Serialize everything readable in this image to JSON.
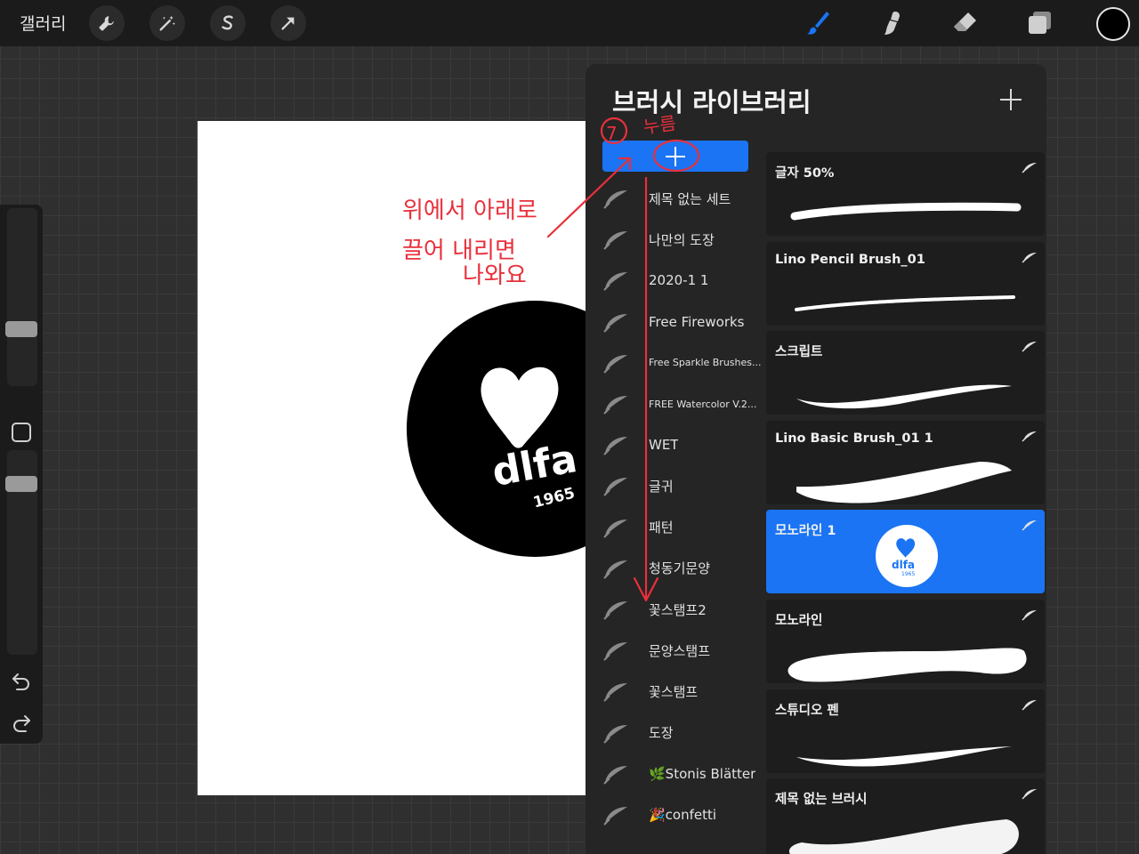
{
  "topbar": {
    "gallery_label": "갤러리",
    "tools": [
      "wrench-icon",
      "magic-wand-icon",
      "selection-icon",
      "transform-arrow-icon"
    ],
    "right_tools": [
      "brush-icon",
      "smudge-icon",
      "eraser-icon",
      "layers-icon"
    ],
    "current_color": "#000000"
  },
  "panel": {
    "title": "브러시 라이브러리",
    "accent_color": "#1a74f4",
    "brush_sets": [
      {
        "label": "제목 없는 세트",
        "small": false
      },
      {
        "label": "나만의 도장",
        "small": false
      },
      {
        "label": "2020-1 1",
        "small": false
      },
      {
        "label": "Free Fireworks",
        "small": false
      },
      {
        "label": "Free Sparkle Brushes...",
        "small": true
      },
      {
        "label": "FREE Watercolor V.2...",
        "small": true
      },
      {
        "label": "WET",
        "small": false
      },
      {
        "label": "글귀",
        "small": false
      },
      {
        "label": "패턴",
        "small": false
      },
      {
        "label": "청동기문양",
        "small": false
      },
      {
        "label": "꽃스탬프2",
        "small": false
      },
      {
        "label": "문양스탬프",
        "small": false
      },
      {
        "label": "꽃스탬프",
        "small": false
      },
      {
        "label": "도장",
        "small": false
      },
      {
        "label": "🌿Stonis Blätter",
        "small": false
      },
      {
        "label": "🎉confetti",
        "small": false
      }
    ],
    "brushes": [
      {
        "name": "글자 50%",
        "selected": false
      },
      {
        "name": "Lino Pencil Brush_01",
        "selected": false
      },
      {
        "name": "스크립트",
        "selected": false
      },
      {
        "name": "Lino Basic Brush_01 1",
        "selected": false
      },
      {
        "name": "모노라인 1",
        "selected": true
      },
      {
        "name": "모노라인",
        "selected": false
      },
      {
        "name": "스튜디오 펜",
        "selected": false
      },
      {
        "name": "제목 없는 브러시",
        "selected": false
      }
    ],
    "mono_preview_text": "dlfa",
    "mono_preview_year": "1965"
  },
  "canvas": {
    "stamp_text": "dlfa",
    "stamp_year": "1965"
  },
  "annotations": {
    "step_number": "7",
    "press_label": "누름",
    "instruction_line1": "위에서 아래로",
    "instruction_line2": "끌어 내리면",
    "instruction_line3": "나와요",
    "color": "#e8303c"
  }
}
